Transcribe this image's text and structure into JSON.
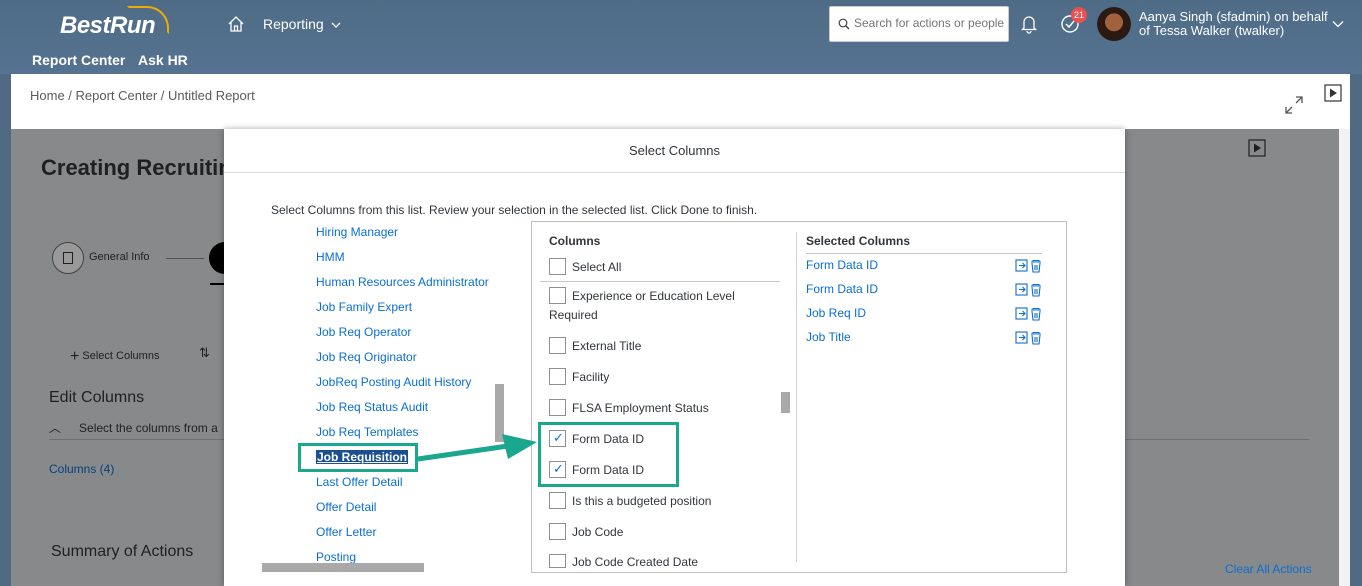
{
  "shell": {
    "logo": "BestRun",
    "nav_reporting": "Reporting",
    "nav_report_center": "Report Center",
    "nav_ask_hr": "Ask HR",
    "search_placeholder": "Search for actions or people",
    "todo_count": "21",
    "user_line1": "Aanya Singh (sfadmin) on behalf",
    "user_line2": "of Tessa Walker (twalker)"
  },
  "page": {
    "breadcrumb": "Home / Report Center / Untitled Report",
    "title": "Creating Recruitin",
    "step1_label": "General Info",
    "select_columns": "Select Columns",
    "edit_columns": "Edit Columns",
    "edit_desc": "Select the columns from a",
    "columns_count": "Columns (4)",
    "summary": "Summary of Actions",
    "clear_all": "Clear All Actions"
  },
  "dialog": {
    "title": "Select Columns",
    "intro": "Select Columns from this list. Review your selection in the selected list. Click Done to finish.",
    "left_items": [
      "Hiring Manager",
      "HMM",
      "Human Resources Administrator",
      "Job Family Expert",
      "Job Req Operator",
      "Job Req Originator",
      "JobReq Posting Audit History",
      "Job Req Status Audit",
      "Job Req Templates",
      "Job Requisition",
      "Last Offer Detail",
      "Offer Detail",
      "Offer Letter",
      "Posting"
    ],
    "selected_left": "Job Requisition",
    "columns_header": "Columns",
    "select_all": "Select All",
    "columns": [
      {
        "label": "Experience or Education Level",
        "label2": "Required",
        "checked": false
      },
      {
        "label": "External Title",
        "checked": false
      },
      {
        "label": "Facility",
        "checked": false
      },
      {
        "label": "FLSA Employment Status",
        "checked": false
      },
      {
        "label": "Form Data ID",
        "checked": true
      },
      {
        "label": "Form Data ID",
        "checked": true
      },
      {
        "label": "Is this a budgeted position",
        "checked": false
      },
      {
        "label": "Job Code",
        "checked": false
      },
      {
        "label": "Job Code Created Date",
        "checked": false
      }
    ],
    "selected_header": "Selected Columns",
    "selected": [
      "Form Data ID",
      "Form Data ID",
      "Job Req ID",
      "Job Title"
    ]
  },
  "colors": {
    "accent": "#0a6ed1",
    "highlight": "#1aa78d",
    "shell": "#4e6c86"
  }
}
